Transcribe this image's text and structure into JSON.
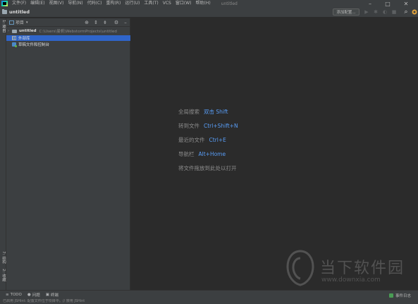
{
  "menubar": {
    "items": [
      "文件(F)",
      "编辑(E)",
      "视图(V)",
      "导航(N)",
      "代码(C)",
      "重构(R)",
      "运行(U)",
      "工具(T)",
      "VCS",
      "窗口(W)",
      "帮助(H)"
    ],
    "window_title": "untitled",
    "controls": [
      "–",
      "□",
      "✕"
    ]
  },
  "navbar": {
    "project_name": "untitled",
    "add_config_label": "添加配置..."
  },
  "toolbar": {
    "icons": [
      "run-icon",
      "debug-icon",
      "coverage-icon",
      "stop-icon",
      "search-icon",
      "update-icon"
    ],
    "run": "▶",
    "debug": "✱",
    "coverage": "◐",
    "stop": "■",
    "search": "⌕"
  },
  "left_strip": {
    "project_tab": "1: 项目",
    "structure_tab": "7: 结构",
    "favorites_tab": "2: 收藏"
  },
  "project_panel": {
    "title": "项目",
    "tools": [
      "locate-icon",
      "expand-icon",
      "collapse-icon",
      "gear-icon",
      "hide-icon"
    ],
    "tree": {
      "root_name": "untitled",
      "root_path": "C:\\Users\\曼帆\\WebstormProjects\\untitled",
      "ext_libs": "外部库",
      "scratches": "草稿文件和控制台"
    }
  },
  "editor": {
    "hints": [
      {
        "label": "全局搜索",
        "shortcut": "双击 Shift"
      },
      {
        "label": "转到文件",
        "shortcut": "Ctrl+Shift+N"
      },
      {
        "label": "最近的文件",
        "shortcut": "Ctrl+E"
      },
      {
        "label": "导航栏",
        "shortcut": "Alt+Home"
      },
      {
        "label": "将文件拖放到此处以打开",
        "shortcut": ""
      }
    ]
  },
  "watermark": {
    "brand": "当下软件园",
    "url": "www.downxia.com"
  },
  "bottom_bar": {
    "todo": "TODO",
    "problems": "问题",
    "terminal": "终端",
    "event_log": "事件日志"
  },
  "status_bar": {
    "message": "已启用 JSHint: 配置文件位于项目中。// 禁用 JSHint"
  },
  "colors": {
    "menubar_bg": "#3c3f41",
    "editor_bg": "#2b2b2b",
    "selection": "#2f65ca",
    "shortcut": "#589df6",
    "event_log_badge": "#499c54"
  }
}
